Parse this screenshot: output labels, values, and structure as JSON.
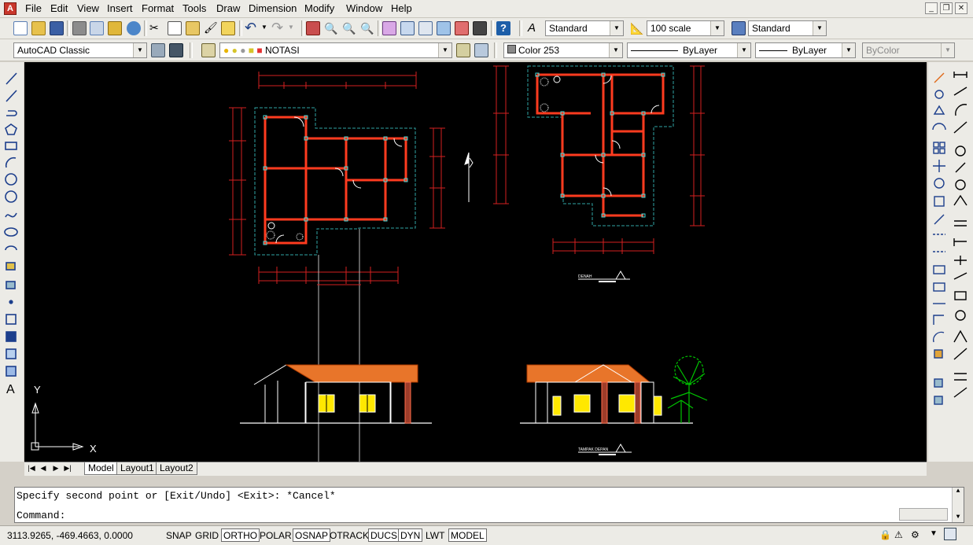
{
  "menu": {
    "items": [
      "File",
      "Edit",
      "View",
      "Insert",
      "Format",
      "Tools",
      "Draw",
      "Dimension",
      "Modify",
      "Window",
      "Help"
    ]
  },
  "toolbar_styles": {
    "text_style": "Standard",
    "dim_style": "100 scale",
    "table_style": "Standard"
  },
  "toolbar_layers": {
    "workspace": "AutoCAD Classic",
    "layer": "NOTASI",
    "color": "Color 253",
    "linetype": "ByLayer",
    "lineweight": "ByLayer",
    "plotstyle": "ByColor"
  },
  "drawing": {
    "label_plan": "DENAH",
    "label_front": "TAMPAK DEPAN",
    "ucs_x": "X",
    "ucs_y": "Y"
  },
  "tabs": {
    "model": "Model",
    "layout1": "Layout1",
    "layout2": "Layout2"
  },
  "command": {
    "history": "Specify second point or [Exit/Undo] <Exit>: *Cancel*",
    "prompt": "Command:"
  },
  "status": {
    "coords": "3113.9265, -469.4663, 0.0000",
    "buttons": [
      {
        "label": "SNAP",
        "on": false
      },
      {
        "label": "GRID",
        "on": false
      },
      {
        "label": "ORTHO",
        "on": true
      },
      {
        "label": "POLAR",
        "on": false
      },
      {
        "label": "OSNAP",
        "on": true
      },
      {
        "label": "OTRACK",
        "on": false
      },
      {
        "label": "DUCS",
        "on": true
      },
      {
        "label": "DYN",
        "on": true
      },
      {
        "label": "LWT",
        "on": false
      },
      {
        "label": "MODEL",
        "on": true
      }
    ]
  },
  "colors": {
    "canvas": "#000000",
    "wall": "#ff3b1f",
    "dimension": "#d42020",
    "roof": "#e8752a",
    "window": "#ffe800",
    "tree": "#00c400",
    "ui_bg": "#ecebe6"
  }
}
